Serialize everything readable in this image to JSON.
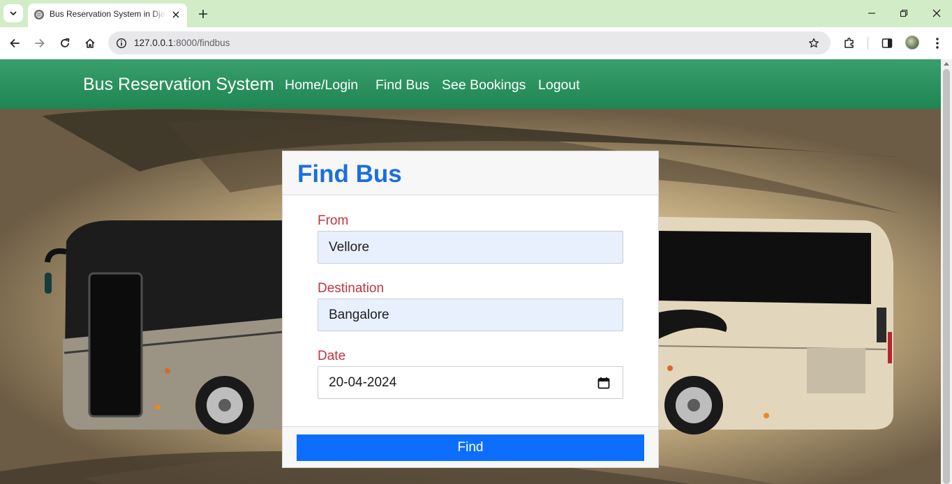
{
  "browser": {
    "tab_title": "Bus Reservation System in Django",
    "url_host": "127.0.0.1",
    "url_rest": ":8000/findbus"
  },
  "navbar": {
    "brand": "Bus Reservation System",
    "links": [
      "Home/Login",
      "Find Bus",
      "See Bookings",
      "Logout"
    ],
    "color": "#2e9460"
  },
  "form": {
    "title": "Find Bus",
    "from_label": "From",
    "from_value": "Vellore",
    "destination_label": "Destination",
    "destination_value": "Bangalore",
    "date_label": "Date",
    "date_value": "20-04-2024",
    "submit_label": "Find",
    "title_color": "#1a6fdc",
    "label_color": "#c0343f",
    "button_color": "#0d6efd"
  }
}
